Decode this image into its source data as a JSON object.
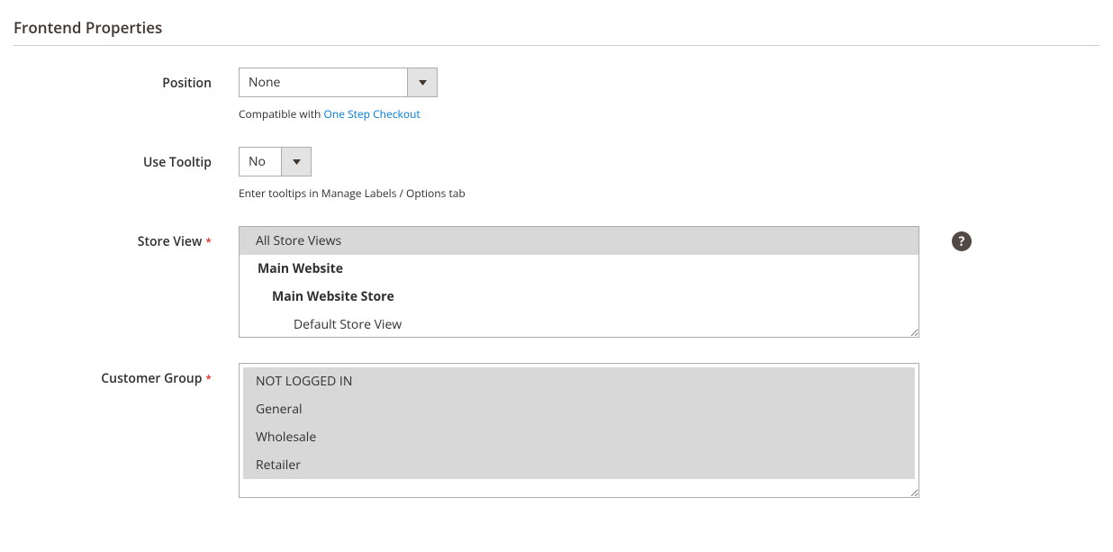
{
  "section": {
    "title": "Frontend Properties"
  },
  "position": {
    "label": "Position",
    "value": "None",
    "note_prefix": "Compatible with ",
    "note_link": "One Step Checkout"
  },
  "tooltip": {
    "label": "Use Tooltip",
    "value": "No",
    "note": "Enter tooltips in Manage Labels / Options tab"
  },
  "storeview": {
    "label": "Store View",
    "options": {
      "o0": "All Store Views",
      "o1": "Main Website",
      "o2": "Main Website Store",
      "o3": "Default Store View"
    }
  },
  "customer_group": {
    "label": "Customer Group",
    "options": {
      "o0": "NOT LOGGED IN",
      "o1": "General",
      "o2": "Wholesale",
      "o3": "Retailer"
    }
  },
  "help": {
    "glyph": "?"
  }
}
